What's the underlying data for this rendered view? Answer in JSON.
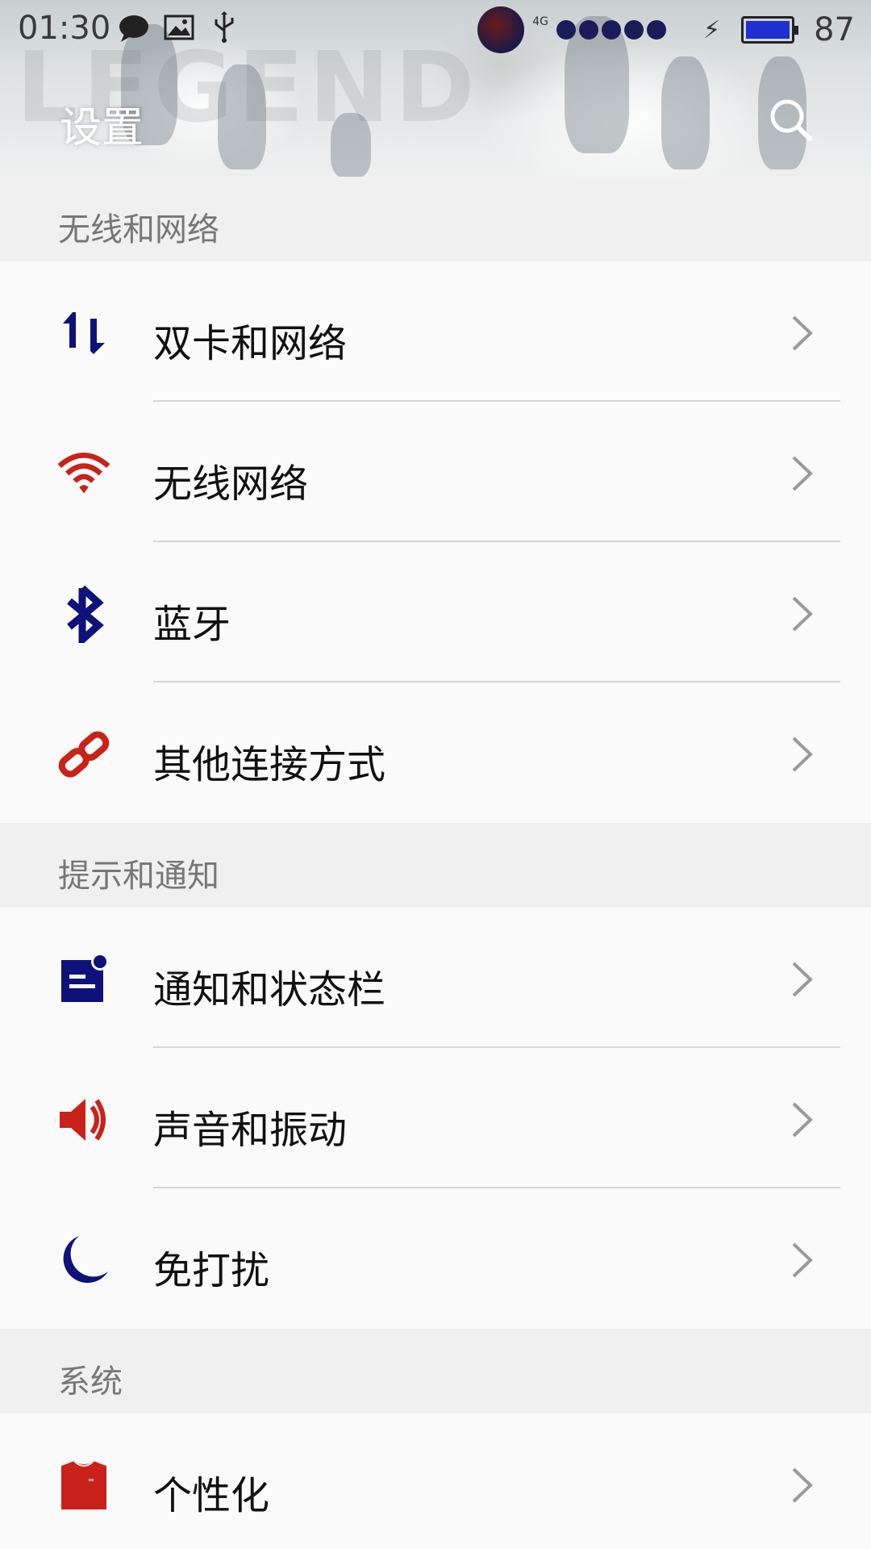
{
  "status_bar": {
    "time": "01:30",
    "network": "4G",
    "battery_level": "87",
    "left_icons": [
      "chat-bubble-icon",
      "image-icon",
      "usb-icon"
    ],
    "right_icons": [
      "basketball-icon",
      "signal-icon",
      "charging-icon",
      "battery-icon"
    ]
  },
  "header": {
    "title": "设置",
    "search_icon": "search-icon"
  },
  "sections": [
    {
      "title": "无线和网络",
      "items": [
        {
          "label": "双卡和网络",
          "icon": "data-transfer-icon",
          "color": "#0f117a"
        },
        {
          "label": "无线网络",
          "icon": "wifi-icon",
          "color": "#c8221a"
        },
        {
          "label": "蓝牙",
          "icon": "bluetooth-icon",
          "color": "#0f117a"
        },
        {
          "label": "其他连接方式",
          "icon": "link-icon",
          "color": "#c8221a"
        }
      ]
    },
    {
      "title": "提示和通知",
      "items": [
        {
          "label": "通知和状态栏",
          "icon": "notification-icon",
          "color": "#0f117a"
        },
        {
          "label": "声音和振动",
          "icon": "speaker-icon",
          "color": "#c8221a"
        },
        {
          "label": "免打扰",
          "icon": "moon-icon",
          "color": "#0f117a"
        }
      ]
    },
    {
      "title": "系统",
      "items": [
        {
          "label": "个性化",
          "icon": "shirt-icon",
          "color": "#c8221a"
        }
      ]
    }
  ]
}
